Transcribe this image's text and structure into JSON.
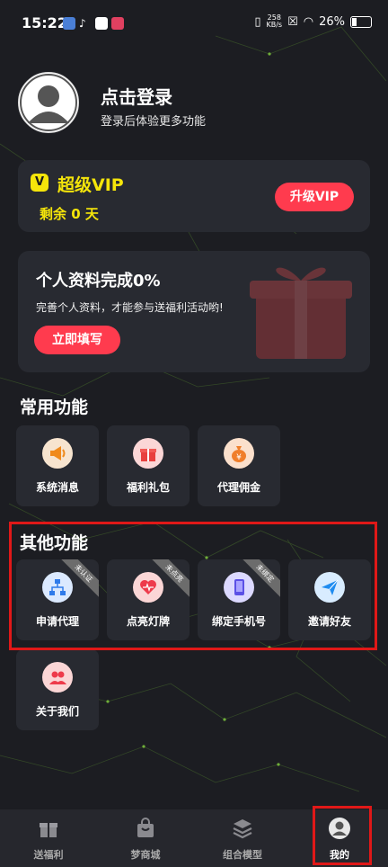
{
  "status_bar": {
    "time": "15:22",
    "speed_value": "258",
    "speed_unit": "KB/s",
    "battery": "26%"
  },
  "profile": {
    "title": "点击登录",
    "subtitle": "登录后体验更多功能"
  },
  "vip": {
    "badge": "V",
    "title": "超级VIP",
    "remaining": "剩余 0 天",
    "button": "升级VIP",
    "accent": "#f5e50a"
  },
  "profile_card": {
    "title": "个人资料完成0%",
    "subtitle": "完善个人资料，才能参与送福利活动哟!",
    "button": "立即填写"
  },
  "common": {
    "title": "常用功能",
    "items": [
      {
        "label": "系统消息",
        "icon": "megaphone-icon"
      },
      {
        "label": "福利礼包",
        "icon": "gift-icon"
      },
      {
        "label": "代理佣金",
        "icon": "money-bag-icon"
      }
    ]
  },
  "other": {
    "title": "其他功能",
    "items": [
      {
        "label": "申请代理",
        "icon": "org-chart-icon",
        "ribbon": "未认证"
      },
      {
        "label": "点亮灯牌",
        "icon": "heart-pulse-icon",
        "ribbon": "未点亮"
      },
      {
        "label": "绑定手机号",
        "icon": "phone-icon",
        "ribbon": "未绑定"
      },
      {
        "label": "邀请好友",
        "icon": "paper-plane-icon"
      },
      {
        "label": "关于我们",
        "icon": "users-icon"
      }
    ]
  },
  "nav": {
    "items": [
      {
        "label": "送福利",
        "icon": "gift-icon"
      },
      {
        "label": "梦商城",
        "icon": "shopping-bag-icon"
      },
      {
        "label": "组合模型",
        "icon": "layers-icon"
      },
      {
        "label": "我的",
        "icon": "user-icon"
      }
    ],
    "active": 3
  },
  "colors": {
    "background": "#1c1d22",
    "card": "#282a31",
    "button": "#ff3b4e",
    "highlight": "#e01818"
  }
}
